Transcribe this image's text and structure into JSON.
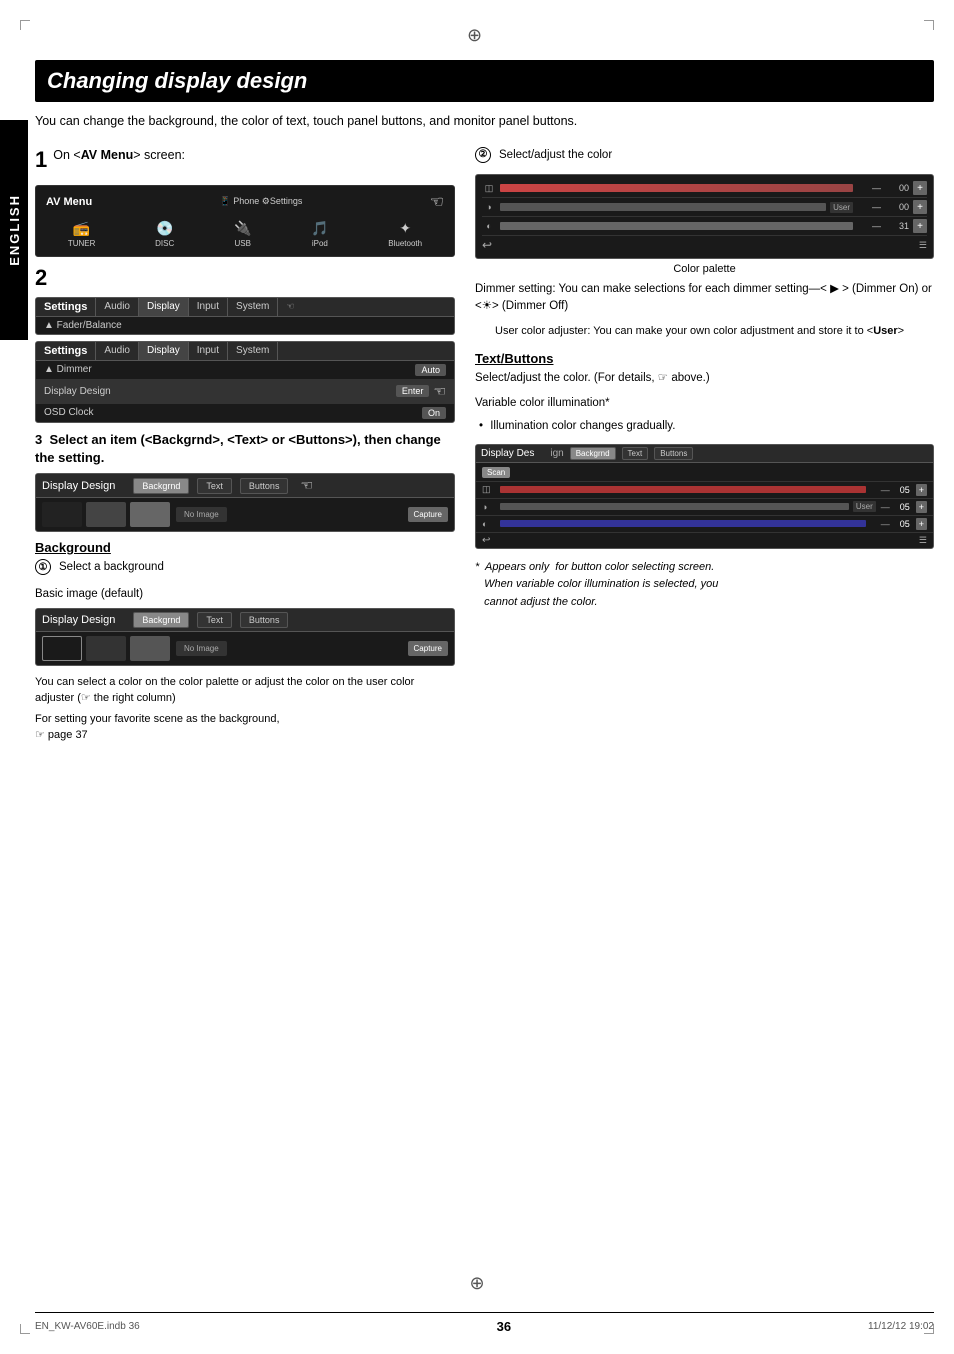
{
  "page": {
    "title": "Changing display design",
    "page_number": "36",
    "file_info": "EN_KW-AV60E.indb   36",
    "date_info": "11/12/12   19:02",
    "intro": "You can change the background, the color of text, touch panel buttons, and monitor panel buttons.",
    "side_tab": "ENGLISH"
  },
  "steps": {
    "step1": {
      "number": "1",
      "text": "On <AV Menu> screen:"
    },
    "step2": {
      "number": "2"
    },
    "step3": {
      "number": "3",
      "text": "Select an item (<Backgrnd>, <Text> or <Buttons>), then change the setting."
    }
  },
  "av_menu": {
    "title": "AV Menu",
    "icons": [
      "Phone",
      "Settings"
    ],
    "items": [
      "TUNER",
      "DISC",
      "USB",
      "iPod",
      "Bluetooth"
    ]
  },
  "settings_screen1": {
    "tabs": [
      "Audio",
      "Display",
      "Input",
      "System"
    ],
    "active_tab": "Display",
    "rows": [
      {
        "label": "Fader/Balance",
        "value": ""
      }
    ]
  },
  "settings_screen2": {
    "tabs": [
      "Audio",
      "Display",
      "Input",
      "System"
    ],
    "active_tab": "Display",
    "rows": [
      {
        "label": "Dimmer",
        "value": "Auto"
      },
      {
        "label": "Display Design",
        "value": "Enter"
      },
      {
        "label": "OSD Clock",
        "value": "On"
      }
    ]
  },
  "display_design": {
    "title": "Display Design",
    "tabs": [
      "Backgrnd",
      "Text",
      "Buttons"
    ],
    "active_tab": "Backgrnd",
    "no_image": "No Image",
    "capture": "Capture"
  },
  "sections": {
    "background": {
      "header": "Background",
      "step1_label": "Select a background",
      "basic_image": "Basic image (default)",
      "color_note": "You can select a color on the color palette or adjust the color on the user color adjuster (☞ the right column)",
      "favorite_note": "For setting your favorite scene as the background, ☞ page 37"
    },
    "right_col": {
      "step2_label": "Select/adjust the color",
      "color_palette_label": "Color palette",
      "dimmer_text": "Dimmer setting: You can make selections for each dimmer setting—< ▶ > (Dimmer On) or <☀> (Dimmer Off)",
      "user_color_text": "User color adjuster: You can make your own color adjustment and store it to <User>",
      "text_buttons_header": "Text/Buttons",
      "text_buttons_note": "Select/adjust the color. (For details, ☞ above.)",
      "var_color_label": "Variable color illumination*",
      "var_color_bullet": "Illumination color changes gradually.",
      "asterisk_note": "*  Appears only  for button color selecting screen. When variable color illumination is selected, you cannot adjust the color."
    }
  },
  "palette": {
    "rows": [
      {
        "icon": "◫",
        "value": "00",
        "has_user": false
      },
      {
        "icon": "◑",
        "value": "00",
        "has_user": true
      },
      {
        "icon": "",
        "value": "31",
        "has_user": false
      }
    ],
    "back_icon": "↩"
  },
  "var_palette": {
    "scan_label": "Scan",
    "rows": [
      {
        "value": "05",
        "color": "r"
      },
      {
        "value": "05",
        "color": "g"
      },
      {
        "value": "05",
        "color": "b"
      }
    ]
  }
}
